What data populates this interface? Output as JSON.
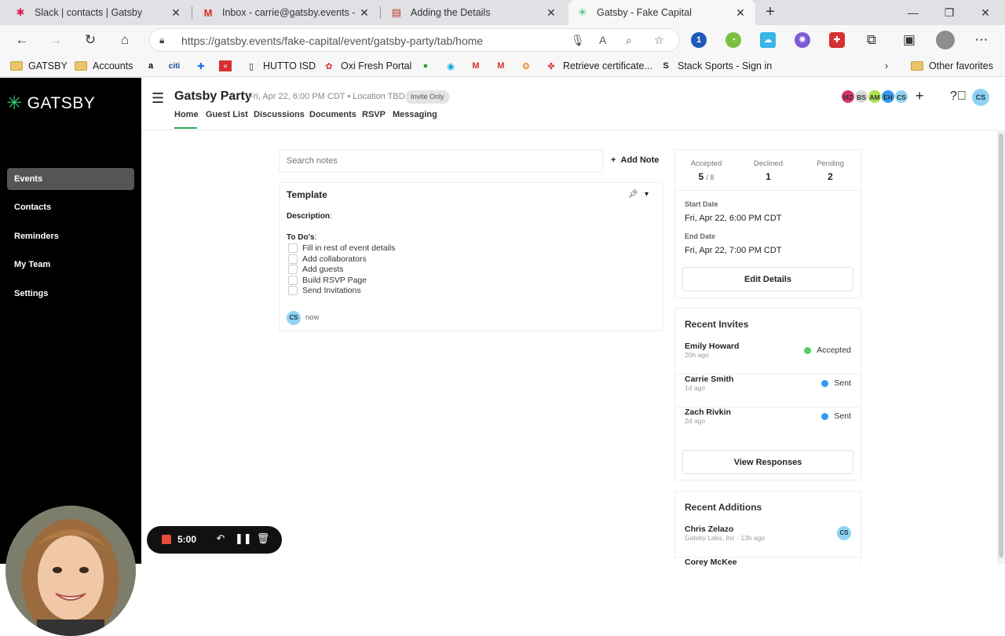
{
  "browser": {
    "tabs": [
      {
        "title": "Slack | contacts | Gatsby",
        "icon": "slack-icon"
      },
      {
        "title": "Inbox - carrie@gatsby.events - G",
        "icon": "gmail-icon"
      },
      {
        "title": "Adding the Details",
        "icon": "doc-icon"
      },
      {
        "title": "Gatsby - Fake Capital",
        "icon": "gatsby-icon",
        "active": true
      }
    ],
    "url": "https://gatsby.events/fake-capital/event/gatsby-party/tab/home",
    "bookmarks": [
      "GATSBY",
      "Accounts",
      "HUTTO ISD",
      "Oxi Fresh Portal",
      "Retrieve certificate...",
      "Stack Sports - Sign in",
      "Other favorites"
    ]
  },
  "sidebar": {
    "logo": "GATSBY",
    "items": [
      {
        "label": "Events",
        "active": true
      },
      {
        "label": "Contacts"
      },
      {
        "label": "Reminders"
      },
      {
        "label": "My Team"
      },
      {
        "label": "Settings"
      }
    ]
  },
  "event": {
    "title": "Gatsby Party",
    "meta": "Fri, Apr 22, 6:00 PM CDT • Location TBD",
    "badge": "Invite Only",
    "tabs": [
      "Home",
      "Guest List",
      "Discussions",
      "Documents",
      "RSVP",
      "Messaging"
    ],
    "collaborators": [
      {
        "initials": "MZ",
        "color": "#d6336c"
      },
      {
        "initials": "BS",
        "color": "#d9d9d9"
      },
      {
        "initials": "AM",
        "color": "#a9e34b"
      },
      {
        "initials": "EH",
        "color": "#339af0"
      },
      {
        "initials": "CS",
        "color": "#8fd3f4"
      }
    ],
    "me_initials": "CS"
  },
  "notes": {
    "search_placeholder": "Search notes",
    "add_label": "Add Note",
    "card": {
      "title": "Template",
      "description_label": "Description",
      "todos_label": "To Do's",
      "todos": [
        "Fill in rest of event details",
        "Add collaborators",
        "Add guests",
        "Build RSVP Page",
        "Send Invitations"
      ],
      "author": "CS",
      "time": "now"
    }
  },
  "summary": {
    "accepted_label": "Accepted",
    "accepted": "5",
    "accepted_total": "/ 8",
    "declined_label": "Declined",
    "declined": "1",
    "pending_label": "Pending",
    "pending": "2",
    "start_label": "Start Date",
    "start": "Fri, Apr 22, 6:00 PM CDT",
    "end_label": "End Date",
    "end": "Fri, Apr 22, 7:00 PM CDT",
    "edit_button": "Edit Details"
  },
  "recent_invites": {
    "title": "Recent Invites",
    "items": [
      {
        "name": "Emily Howard",
        "ago": "20h ago",
        "status": "Accepted",
        "color": "#51cf66"
      },
      {
        "name": "Carrie Smith",
        "ago": "1d ago",
        "status": "Sent",
        "color": "#339af0"
      },
      {
        "name": "Zach Rivkin",
        "ago": "2d ago",
        "status": "Sent",
        "color": "#339af0"
      }
    ],
    "button": "View Responses"
  },
  "recent_additions": {
    "title": "Recent Additions",
    "items": [
      {
        "name": "Chris Zelazo",
        "sub": "Gatsby Labs, Inc · 13h ago",
        "initials": "CS"
      },
      {
        "name": "Corey McKee"
      }
    ]
  },
  "recorder": {
    "time": "5:00"
  }
}
